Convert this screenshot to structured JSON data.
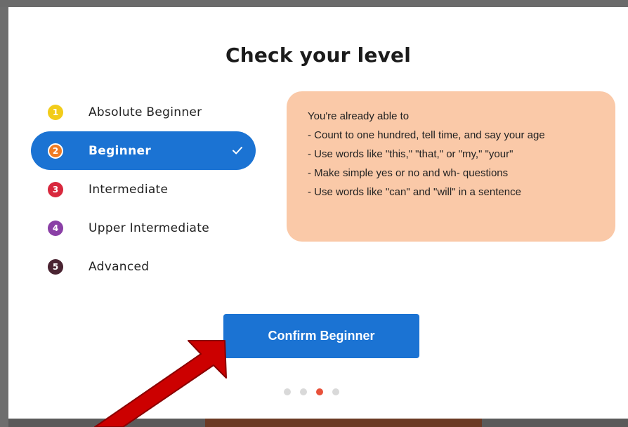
{
  "title": "Check your level",
  "levels": [
    {
      "number": "1",
      "label": "Absolute Beginner",
      "color": "#f2cc1a",
      "selected": false
    },
    {
      "number": "2",
      "label": "Beginner",
      "color": "#f07b22",
      "selected": true
    },
    {
      "number": "3",
      "label": "Intermediate",
      "color": "#d8283d",
      "selected": false
    },
    {
      "number": "4",
      "label": "Upper Intermediate",
      "color": "#8a3fa6",
      "selected": false
    },
    {
      "number": "5",
      "label": "Advanced",
      "color": "#4a2432",
      "selected": false
    }
  ],
  "info": {
    "lines": [
      "You're already able to",
      "- Count to one hundred, tell time, and say your age",
      "- Use words like \"this,\" \"that,\" or \"my,\" \"your\"",
      "- Make simple yes or no and wh- questions",
      "- Use words like \"can\" and \"will\" in a sentence"
    ],
    "background": "#fac9a8"
  },
  "confirm_label": "Confirm Beginner",
  "pagination": {
    "count": 4,
    "active_index": 2
  },
  "colors": {
    "accent": "#1b73d3",
    "arrow": "#cc0000",
    "active_dot": "#e8513a"
  }
}
